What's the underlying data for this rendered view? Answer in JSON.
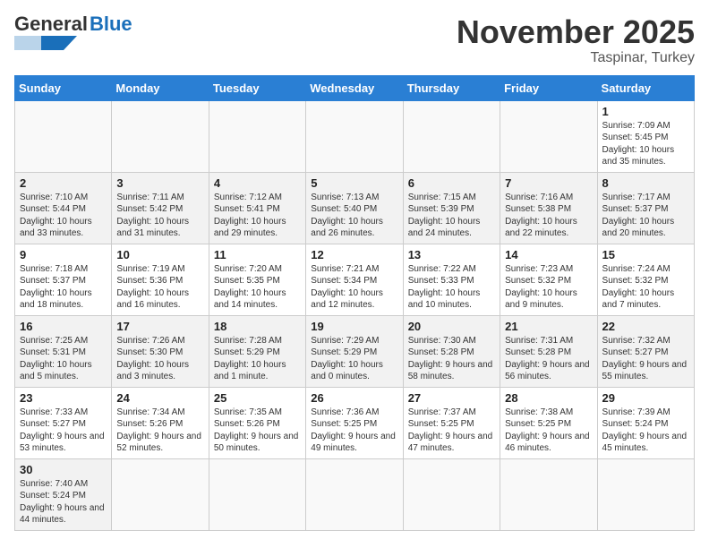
{
  "header": {
    "logo_text_general": "General",
    "logo_text_blue": "Blue",
    "month_title": "November 2025",
    "subtitle": "Taspinar, Turkey"
  },
  "weekdays": [
    "Sunday",
    "Monday",
    "Tuesday",
    "Wednesday",
    "Thursday",
    "Friday",
    "Saturday"
  ],
  "weeks": [
    [
      {
        "day": "",
        "info": ""
      },
      {
        "day": "",
        "info": ""
      },
      {
        "day": "",
        "info": ""
      },
      {
        "day": "",
        "info": ""
      },
      {
        "day": "",
        "info": ""
      },
      {
        "day": "",
        "info": ""
      },
      {
        "day": "1",
        "info": "Sunrise: 7:09 AM\nSunset: 5:45 PM\nDaylight: 10 hours\nand 35 minutes."
      }
    ],
    [
      {
        "day": "2",
        "info": "Sunrise: 7:10 AM\nSunset: 5:44 PM\nDaylight: 10 hours\nand 33 minutes."
      },
      {
        "day": "3",
        "info": "Sunrise: 7:11 AM\nSunset: 5:42 PM\nDaylight: 10 hours\nand 31 minutes."
      },
      {
        "day": "4",
        "info": "Sunrise: 7:12 AM\nSunset: 5:41 PM\nDaylight: 10 hours\nand 29 minutes."
      },
      {
        "day": "5",
        "info": "Sunrise: 7:13 AM\nSunset: 5:40 PM\nDaylight: 10 hours\nand 26 minutes."
      },
      {
        "day": "6",
        "info": "Sunrise: 7:15 AM\nSunset: 5:39 PM\nDaylight: 10 hours\nand 24 minutes."
      },
      {
        "day": "7",
        "info": "Sunrise: 7:16 AM\nSunset: 5:38 PM\nDaylight: 10 hours\nand 22 minutes."
      },
      {
        "day": "8",
        "info": "Sunrise: 7:17 AM\nSunset: 5:37 PM\nDaylight: 10 hours\nand 20 minutes."
      }
    ],
    [
      {
        "day": "9",
        "info": "Sunrise: 7:18 AM\nSunset: 5:37 PM\nDaylight: 10 hours\nand 18 minutes."
      },
      {
        "day": "10",
        "info": "Sunrise: 7:19 AM\nSunset: 5:36 PM\nDaylight: 10 hours\nand 16 minutes."
      },
      {
        "day": "11",
        "info": "Sunrise: 7:20 AM\nSunset: 5:35 PM\nDaylight: 10 hours\nand 14 minutes."
      },
      {
        "day": "12",
        "info": "Sunrise: 7:21 AM\nSunset: 5:34 PM\nDaylight: 10 hours\nand 12 minutes."
      },
      {
        "day": "13",
        "info": "Sunrise: 7:22 AM\nSunset: 5:33 PM\nDaylight: 10 hours\nand 10 minutes."
      },
      {
        "day": "14",
        "info": "Sunrise: 7:23 AM\nSunset: 5:32 PM\nDaylight: 10 hours\nand 9 minutes."
      },
      {
        "day": "15",
        "info": "Sunrise: 7:24 AM\nSunset: 5:32 PM\nDaylight: 10 hours\nand 7 minutes."
      }
    ],
    [
      {
        "day": "16",
        "info": "Sunrise: 7:25 AM\nSunset: 5:31 PM\nDaylight: 10 hours\nand 5 minutes."
      },
      {
        "day": "17",
        "info": "Sunrise: 7:26 AM\nSunset: 5:30 PM\nDaylight: 10 hours\nand 3 minutes."
      },
      {
        "day": "18",
        "info": "Sunrise: 7:28 AM\nSunset: 5:29 PM\nDaylight: 10 hours\nand 1 minute."
      },
      {
        "day": "19",
        "info": "Sunrise: 7:29 AM\nSunset: 5:29 PM\nDaylight: 10 hours\nand 0 minutes."
      },
      {
        "day": "20",
        "info": "Sunrise: 7:30 AM\nSunset: 5:28 PM\nDaylight: 9 hours\nand 58 minutes."
      },
      {
        "day": "21",
        "info": "Sunrise: 7:31 AM\nSunset: 5:28 PM\nDaylight: 9 hours\nand 56 minutes."
      },
      {
        "day": "22",
        "info": "Sunrise: 7:32 AM\nSunset: 5:27 PM\nDaylight: 9 hours\nand 55 minutes."
      }
    ],
    [
      {
        "day": "23",
        "info": "Sunrise: 7:33 AM\nSunset: 5:27 PM\nDaylight: 9 hours\nand 53 minutes."
      },
      {
        "day": "24",
        "info": "Sunrise: 7:34 AM\nSunset: 5:26 PM\nDaylight: 9 hours\nand 52 minutes."
      },
      {
        "day": "25",
        "info": "Sunrise: 7:35 AM\nSunset: 5:26 PM\nDaylight: 9 hours\nand 50 minutes."
      },
      {
        "day": "26",
        "info": "Sunrise: 7:36 AM\nSunset: 5:25 PM\nDaylight: 9 hours\nand 49 minutes."
      },
      {
        "day": "27",
        "info": "Sunrise: 7:37 AM\nSunset: 5:25 PM\nDaylight: 9 hours\nand 47 minutes."
      },
      {
        "day": "28",
        "info": "Sunrise: 7:38 AM\nSunset: 5:25 PM\nDaylight: 9 hours\nand 46 minutes."
      },
      {
        "day": "29",
        "info": "Sunrise: 7:39 AM\nSunset: 5:24 PM\nDaylight: 9 hours\nand 45 minutes."
      }
    ],
    [
      {
        "day": "30",
        "info": "Sunrise: 7:40 AM\nSunset: 5:24 PM\nDaylight: 9 hours\nand 44 minutes."
      },
      {
        "day": "",
        "info": ""
      },
      {
        "day": "",
        "info": ""
      },
      {
        "day": "",
        "info": ""
      },
      {
        "day": "",
        "info": ""
      },
      {
        "day": "",
        "info": ""
      },
      {
        "day": "",
        "info": ""
      }
    ]
  ]
}
